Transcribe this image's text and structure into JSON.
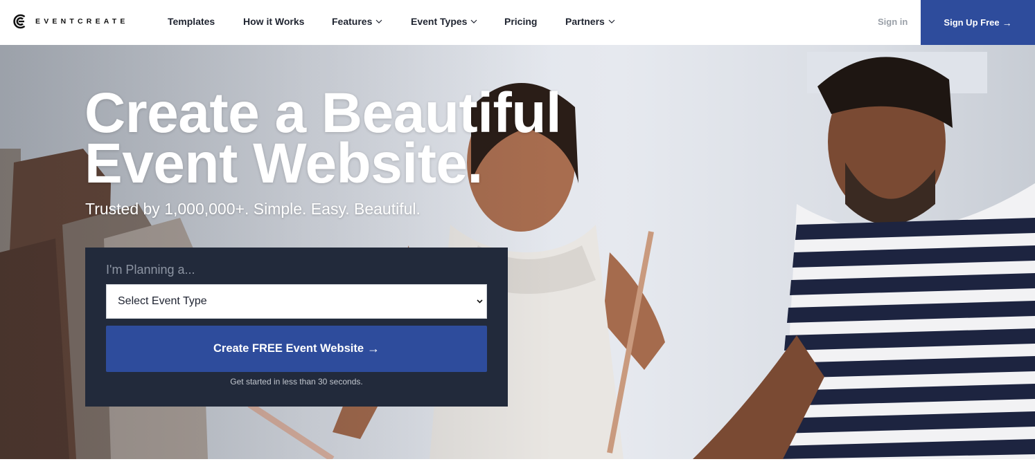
{
  "brand": {
    "name": "EVENTCREATE",
    "icon": "eventcreate-logo-icon",
    "accent": "#2e4c9c"
  },
  "nav": {
    "items": [
      {
        "label": "Templates",
        "dropdown": false
      },
      {
        "label": "How it Works",
        "dropdown": false
      },
      {
        "label": "Features",
        "dropdown": true
      },
      {
        "label": "Event Types",
        "dropdown": true
      },
      {
        "label": "Pricing",
        "dropdown": false
      },
      {
        "label": "Partners",
        "dropdown": true
      }
    ],
    "signin": "Sign in",
    "signup": "Sign Up Free",
    "signup_icon": "arrow-right-icon"
  },
  "hero": {
    "headline_line1": "Create a Beautiful",
    "headline_line2": "Event Website.",
    "subheadline": "Trusted by 1,000,000+. Simple. Easy. Beautiful.",
    "form": {
      "label": "I'm Planning a...",
      "select_value": "Select Event Type",
      "cta": "Create FREE Event Website",
      "cta_icon": "arrow-right-icon",
      "note": "Get started in less than 30 seconds."
    },
    "panel_color": "#222a3b"
  }
}
